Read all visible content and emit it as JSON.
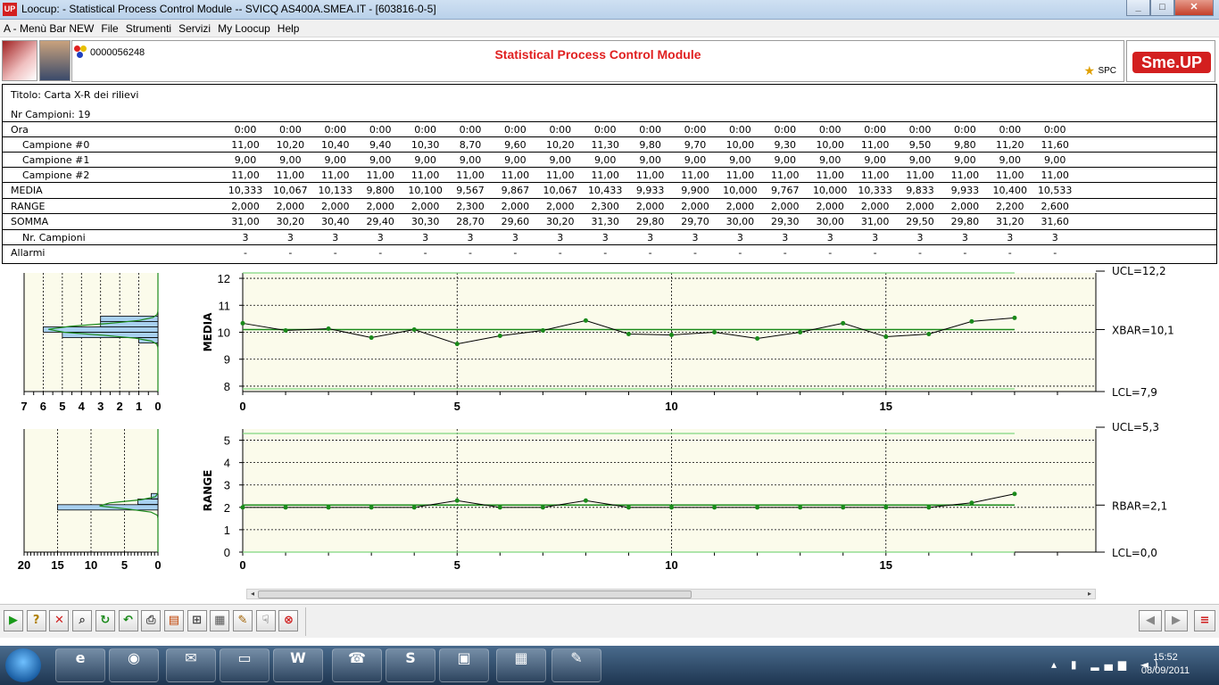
{
  "window": {
    "title": "Loocup:  - Statistical Process Control Module -- SVICQ AS400A.SMEA.IT - [603816-0-5]",
    "app_icon": "UP"
  },
  "menu": [
    "A - Menù Bar NEW",
    "File",
    "Strumenti",
    "Servizi",
    "My Loocup",
    "Help"
  ],
  "header": {
    "code": "0000056248",
    "title": "Statistical Process Control Module",
    "spc_label": "SPC",
    "logo_text": "Sme.UP"
  },
  "table": {
    "titolo": "Titolo: Carta X-R dei rilievi",
    "nr_campioni": "Nr Campioni: 19",
    "rows": [
      {
        "label": "Ora",
        "indent": false,
        "values": [
          "0:00",
          "0:00",
          "0:00",
          "0:00",
          "0:00",
          "0:00",
          "0:00",
          "0:00",
          "0:00",
          "0:00",
          "0:00",
          "0:00",
          "0:00",
          "0:00",
          "0:00",
          "0:00",
          "0:00",
          "0:00",
          "0:00"
        ]
      },
      {
        "label": "Campione #0",
        "indent": true,
        "values": [
          "11,00",
          "10,20",
          "10,40",
          "9,40",
          "10,30",
          "8,70",
          "9,60",
          "10,20",
          "11,30",
          "9,80",
          "9,70",
          "10,00",
          "9,30",
          "10,00",
          "11,00",
          "9,50",
          "9,80",
          "11,20",
          "11,60"
        ]
      },
      {
        "label": "Campione #1",
        "indent": true,
        "values": [
          "9,00",
          "9,00",
          "9,00",
          "9,00",
          "9,00",
          "9,00",
          "9,00",
          "9,00",
          "9,00",
          "9,00",
          "9,00",
          "9,00",
          "9,00",
          "9,00",
          "9,00",
          "9,00",
          "9,00",
          "9,00",
          "9,00"
        ]
      },
      {
        "label": "Campione #2",
        "indent": true,
        "values": [
          "11,00",
          "11,00",
          "11,00",
          "11,00",
          "11,00",
          "11,00",
          "11,00",
          "11,00",
          "11,00",
          "11,00",
          "11,00",
          "11,00",
          "11,00",
          "11,00",
          "11,00",
          "11,00",
          "11,00",
          "11,00",
          "11,00"
        ]
      },
      {
        "label": "MEDIA",
        "indent": false,
        "values": [
          "10,333",
          "10,067",
          "10,133",
          "9,800",
          "10,100",
          "9,567",
          "9,867",
          "10,067",
          "10,433",
          "9,933",
          "9,900",
          "10,000",
          "9,767",
          "10,000",
          "10,333",
          "9,833",
          "9,933",
          "10,400",
          "10,533"
        ]
      },
      {
        "label": "RANGE",
        "indent": false,
        "values": [
          "2,000",
          "2,000",
          "2,000",
          "2,000",
          "2,000",
          "2,300",
          "2,000",
          "2,000",
          "2,300",
          "2,000",
          "2,000",
          "2,000",
          "2,000",
          "2,000",
          "2,000",
          "2,000",
          "2,000",
          "2,200",
          "2,600"
        ]
      },
      {
        "label": "SOMMA",
        "indent": false,
        "values": [
          "31,00",
          "30,20",
          "30,40",
          "29,40",
          "30,30",
          "28,70",
          "29,60",
          "30,20",
          "31,30",
          "29,80",
          "29,70",
          "30,00",
          "29,30",
          "30,00",
          "31,00",
          "29,50",
          "29,80",
          "31,20",
          "31,60"
        ]
      },
      {
        "label": "Nr. Campioni",
        "indent": true,
        "values": [
          "3",
          "3",
          "3",
          "3",
          "3",
          "3",
          "3",
          "3",
          "3",
          "3",
          "3",
          "3",
          "3",
          "3",
          "3",
          "3",
          "3",
          "3",
          "3"
        ]
      },
      {
        "label": "Allarmi",
        "indent": false,
        "values": [
          "-",
          "-",
          "-",
          "-",
          "-",
          "-",
          "-",
          "-",
          "-",
          "-",
          "-",
          "-",
          "-",
          "-",
          "-",
          "-",
          "-",
          "-",
          "-"
        ]
      }
    ]
  },
  "chart_data": [
    {
      "type": "line",
      "ylabel": "MEDIA",
      "x": [
        0,
        1,
        2,
        3,
        4,
        5,
        6,
        7,
        8,
        9,
        10,
        11,
        12,
        13,
        14,
        15,
        16,
        17,
        18
      ],
      "values": [
        10.333,
        10.067,
        10.133,
        9.8,
        10.1,
        9.567,
        9.867,
        10.067,
        10.433,
        9.933,
        9.9,
        10.0,
        9.767,
        10.0,
        10.333,
        9.833,
        9.933,
        10.4,
        10.533
      ],
      "ylim": [
        7.8,
        12.2
      ],
      "xlim": [
        0,
        19
      ],
      "yticks": [
        "8",
        "9",
        "10",
        "11",
        "12"
      ],
      "xticks": [
        "0",
        "5",
        "10",
        "15"
      ],
      "control_labels": {
        "ucl": "UCL=12,2",
        "center": "XBAR=10,1",
        "lcl": "LCL=7,9"
      },
      "control_values": {
        "ucl": 12.2,
        "center": 10.1,
        "lcl": 7.9
      },
      "hist_axis": [
        "7",
        "6",
        "5",
        "4",
        "3",
        "2",
        "1",
        "0"
      ],
      "hist_bins": [
        {
          "y": 10.5,
          "count": 3
        },
        {
          "y": 10.3,
          "count": 3
        },
        {
          "y": 10.1,
          "count": 6
        },
        {
          "y": 9.9,
          "count": 5
        },
        {
          "y": 9.7,
          "count": 1
        }
      ]
    },
    {
      "type": "line",
      "ylabel": "RANGE",
      "x": [
        0,
        1,
        2,
        3,
        4,
        5,
        6,
        7,
        8,
        9,
        10,
        11,
        12,
        13,
        14,
        15,
        16,
        17,
        18
      ],
      "values": [
        2.0,
        2.0,
        2.0,
        2.0,
        2.0,
        2.3,
        2.0,
        2.0,
        2.3,
        2.0,
        2.0,
        2.0,
        2.0,
        2.0,
        2.0,
        2.0,
        2.0,
        2.2,
        2.6
      ],
      "ylim": [
        0,
        5.5
      ],
      "xlim": [
        0,
        19
      ],
      "yticks": [
        "0",
        "1",
        "2",
        "3",
        "4",
        "5"
      ],
      "xticks": [
        "0",
        "5",
        "10",
        "15"
      ],
      "control_labels": {
        "ucl": "UCL=5,3",
        "center": "RBAR=2,1",
        "lcl": "LCL=0,0"
      },
      "control_values": {
        "ucl": 5.3,
        "center": 2.1,
        "lcl": 0.0
      },
      "hist_axis": [
        "20",
        "15",
        "10",
        "5",
        "0"
      ],
      "hist_bins": [
        {
          "y": 2.5,
          "count": 1
        },
        {
          "y": 2.25,
          "count": 3
        },
        {
          "y": 2.0,
          "count": 15
        }
      ]
    }
  ],
  "colors": {
    "line": "#000000",
    "point": "#1a8a1a",
    "center": "#1a8a1a",
    "ucl_top": "#7fd67f",
    "hist_fill": "#a8d0f0",
    "plot_bg": "#fbfbeb"
  },
  "toolbar": [
    {
      "name": "run-icon",
      "glyph": "▶"
    },
    {
      "name": "help-icon",
      "glyph": "?"
    },
    {
      "name": "delete-icon",
      "glyph": "✕"
    },
    {
      "name": "zoom-icon",
      "glyph": "⌕"
    },
    {
      "name": "refresh-icon",
      "glyph": "↻"
    },
    {
      "name": "back-icon",
      "glyph": "↶"
    },
    {
      "name": "print-icon",
      "glyph": "⎙"
    },
    {
      "name": "export-icon",
      "glyph": "▤"
    },
    {
      "name": "cart-icon",
      "glyph": "⊞"
    },
    {
      "name": "image-icon",
      "glyph": "▦"
    },
    {
      "name": "tools-icon",
      "glyph": "✎"
    },
    {
      "name": "select-icon",
      "glyph": "☟"
    },
    {
      "name": "stop-icon",
      "glyph": "⊗"
    }
  ],
  "nav": {
    "prev": "◀",
    "next": "▶",
    "menu": "≡"
  },
  "taskbar": {
    "time": "15:52",
    "date": "08/09/2011"
  }
}
